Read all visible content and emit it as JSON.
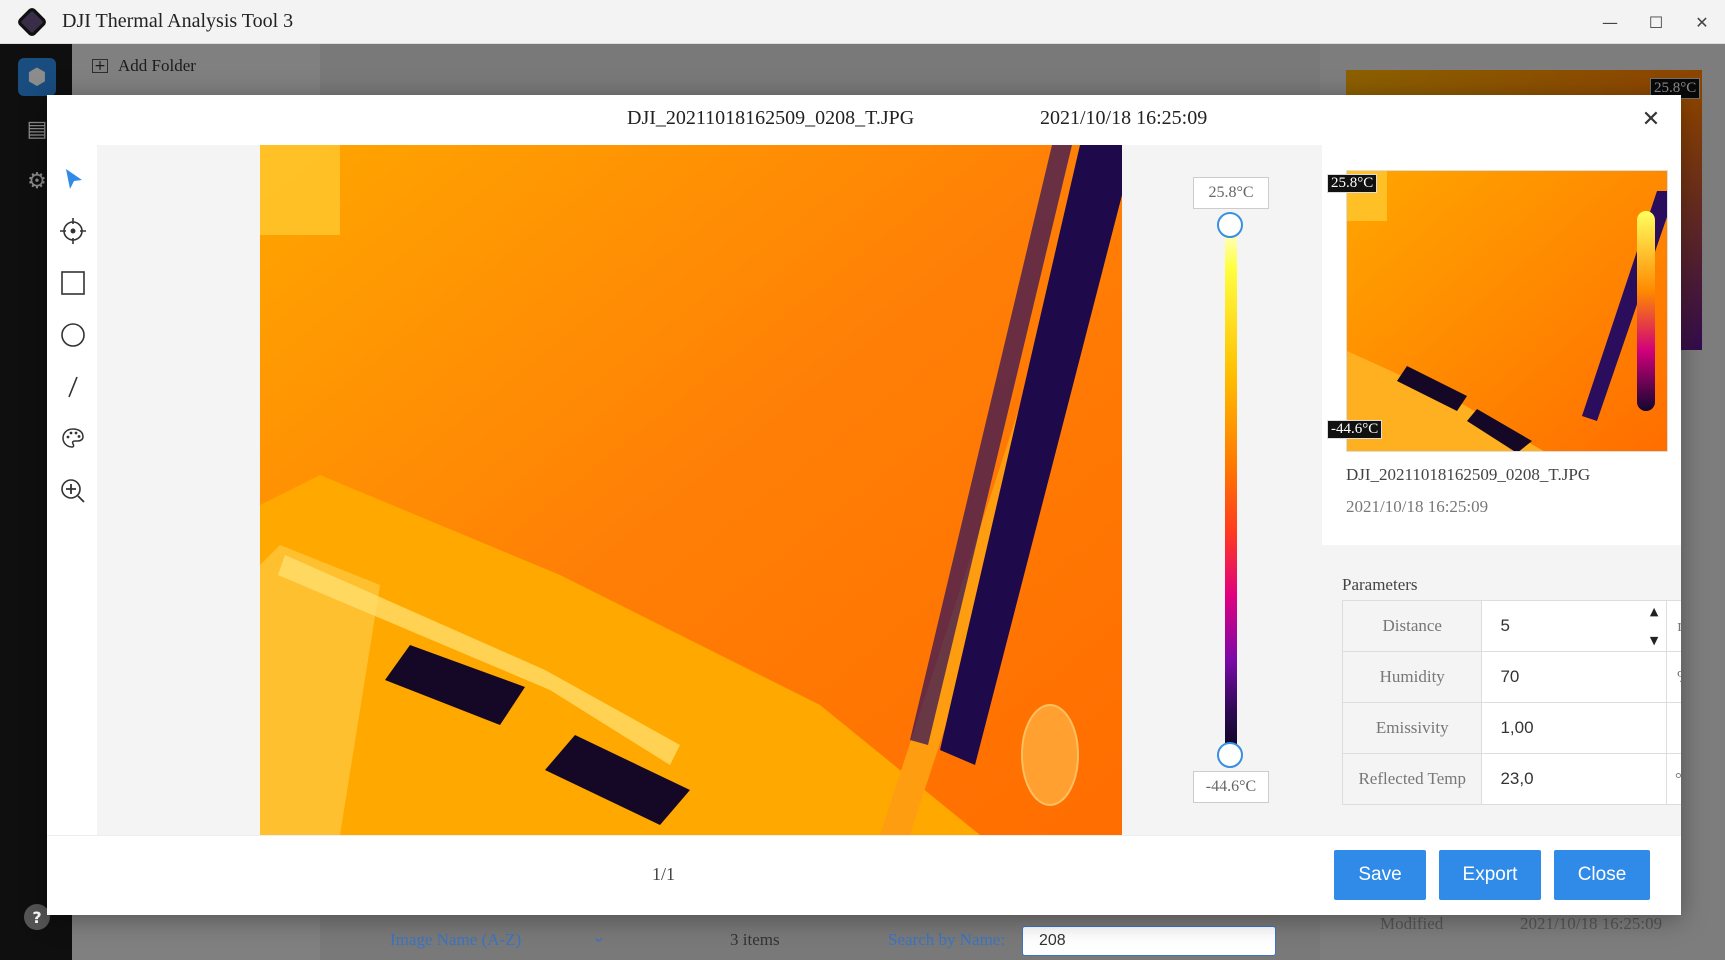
{
  "app": {
    "title": "DJI Thermal Analysis Tool 3"
  },
  "window": {
    "minimize": "—",
    "maximize": "☐",
    "close": "✕"
  },
  "background": {
    "add_folder": "Add Folder",
    "thumb_max": "25.8°C",
    "sort_label": "Image Name (A-Z)",
    "items_count": "3 items",
    "search_label": "Search by Name:",
    "search_value": "208",
    "modified_label": "Modified",
    "modified_value": "2021/10/18 16:25:09"
  },
  "modal": {
    "filename": "DJI_20211018162509_0208_T.JPG",
    "datetime": "2021/10/18 16:25:09",
    "scale": {
      "max": "25.8°C",
      "min": "-44.6°C",
      "upper_handle_level": 1.0,
      "lower_handle_level": 0.0
    },
    "info": {
      "preview_max": "25.8°C",
      "preview_min": "-44.6°C",
      "name": "DJI_20211018162509_0208_T.JPG",
      "date": "2021/10/18 16:25:09"
    },
    "parameters": {
      "title": "Parameters",
      "rows": [
        {
          "label": "Distance",
          "value": "5",
          "unit": "m"
        },
        {
          "label": "Humidity",
          "value": "70",
          "unit": "%"
        },
        {
          "label": "Emissivity",
          "value": "1,00",
          "unit": ""
        },
        {
          "label": "Reflected Temp",
          "value": "23,0",
          "unit": "°C"
        }
      ]
    },
    "pager": "1/1",
    "buttons": {
      "save": "Save",
      "export": "Export",
      "close": "Close"
    }
  },
  "colors": {
    "accent": "#2f8ae8",
    "highlight": "#ffff33"
  }
}
